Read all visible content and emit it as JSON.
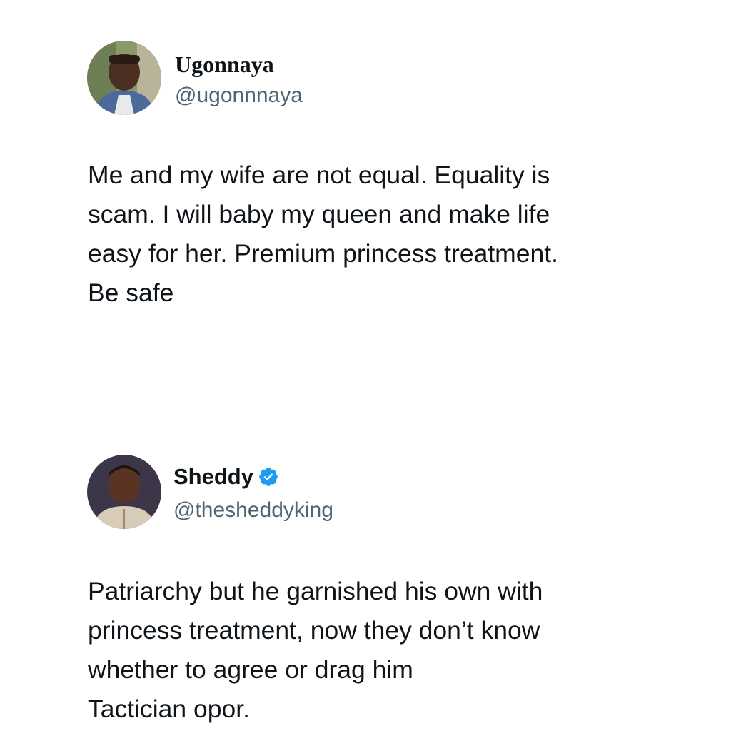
{
  "tweets": [
    {
      "display_name": "Ugonnaya",
      "handle": "@ugonnnaya",
      "verified": false,
      "avatar_icon": "profile-photo-man",
      "text": "Me and my wife are not equal. Equality is\nscam. I will baby my queen and make life\neasy for her. Premium princess treatment.\nBe safe"
    },
    {
      "display_name": "Sheddy",
      "handle": "@thesheddyking",
      "verified": true,
      "verified_icon": "verified-badge-icon",
      "verified_color": "#1d9bf0",
      "avatar_icon": "profile-photo-child",
      "text": "Patriarchy but he garnished his own with\nprincess treatment, now they don’t know\nwhether to agree or drag him\nTactician opor."
    }
  ]
}
